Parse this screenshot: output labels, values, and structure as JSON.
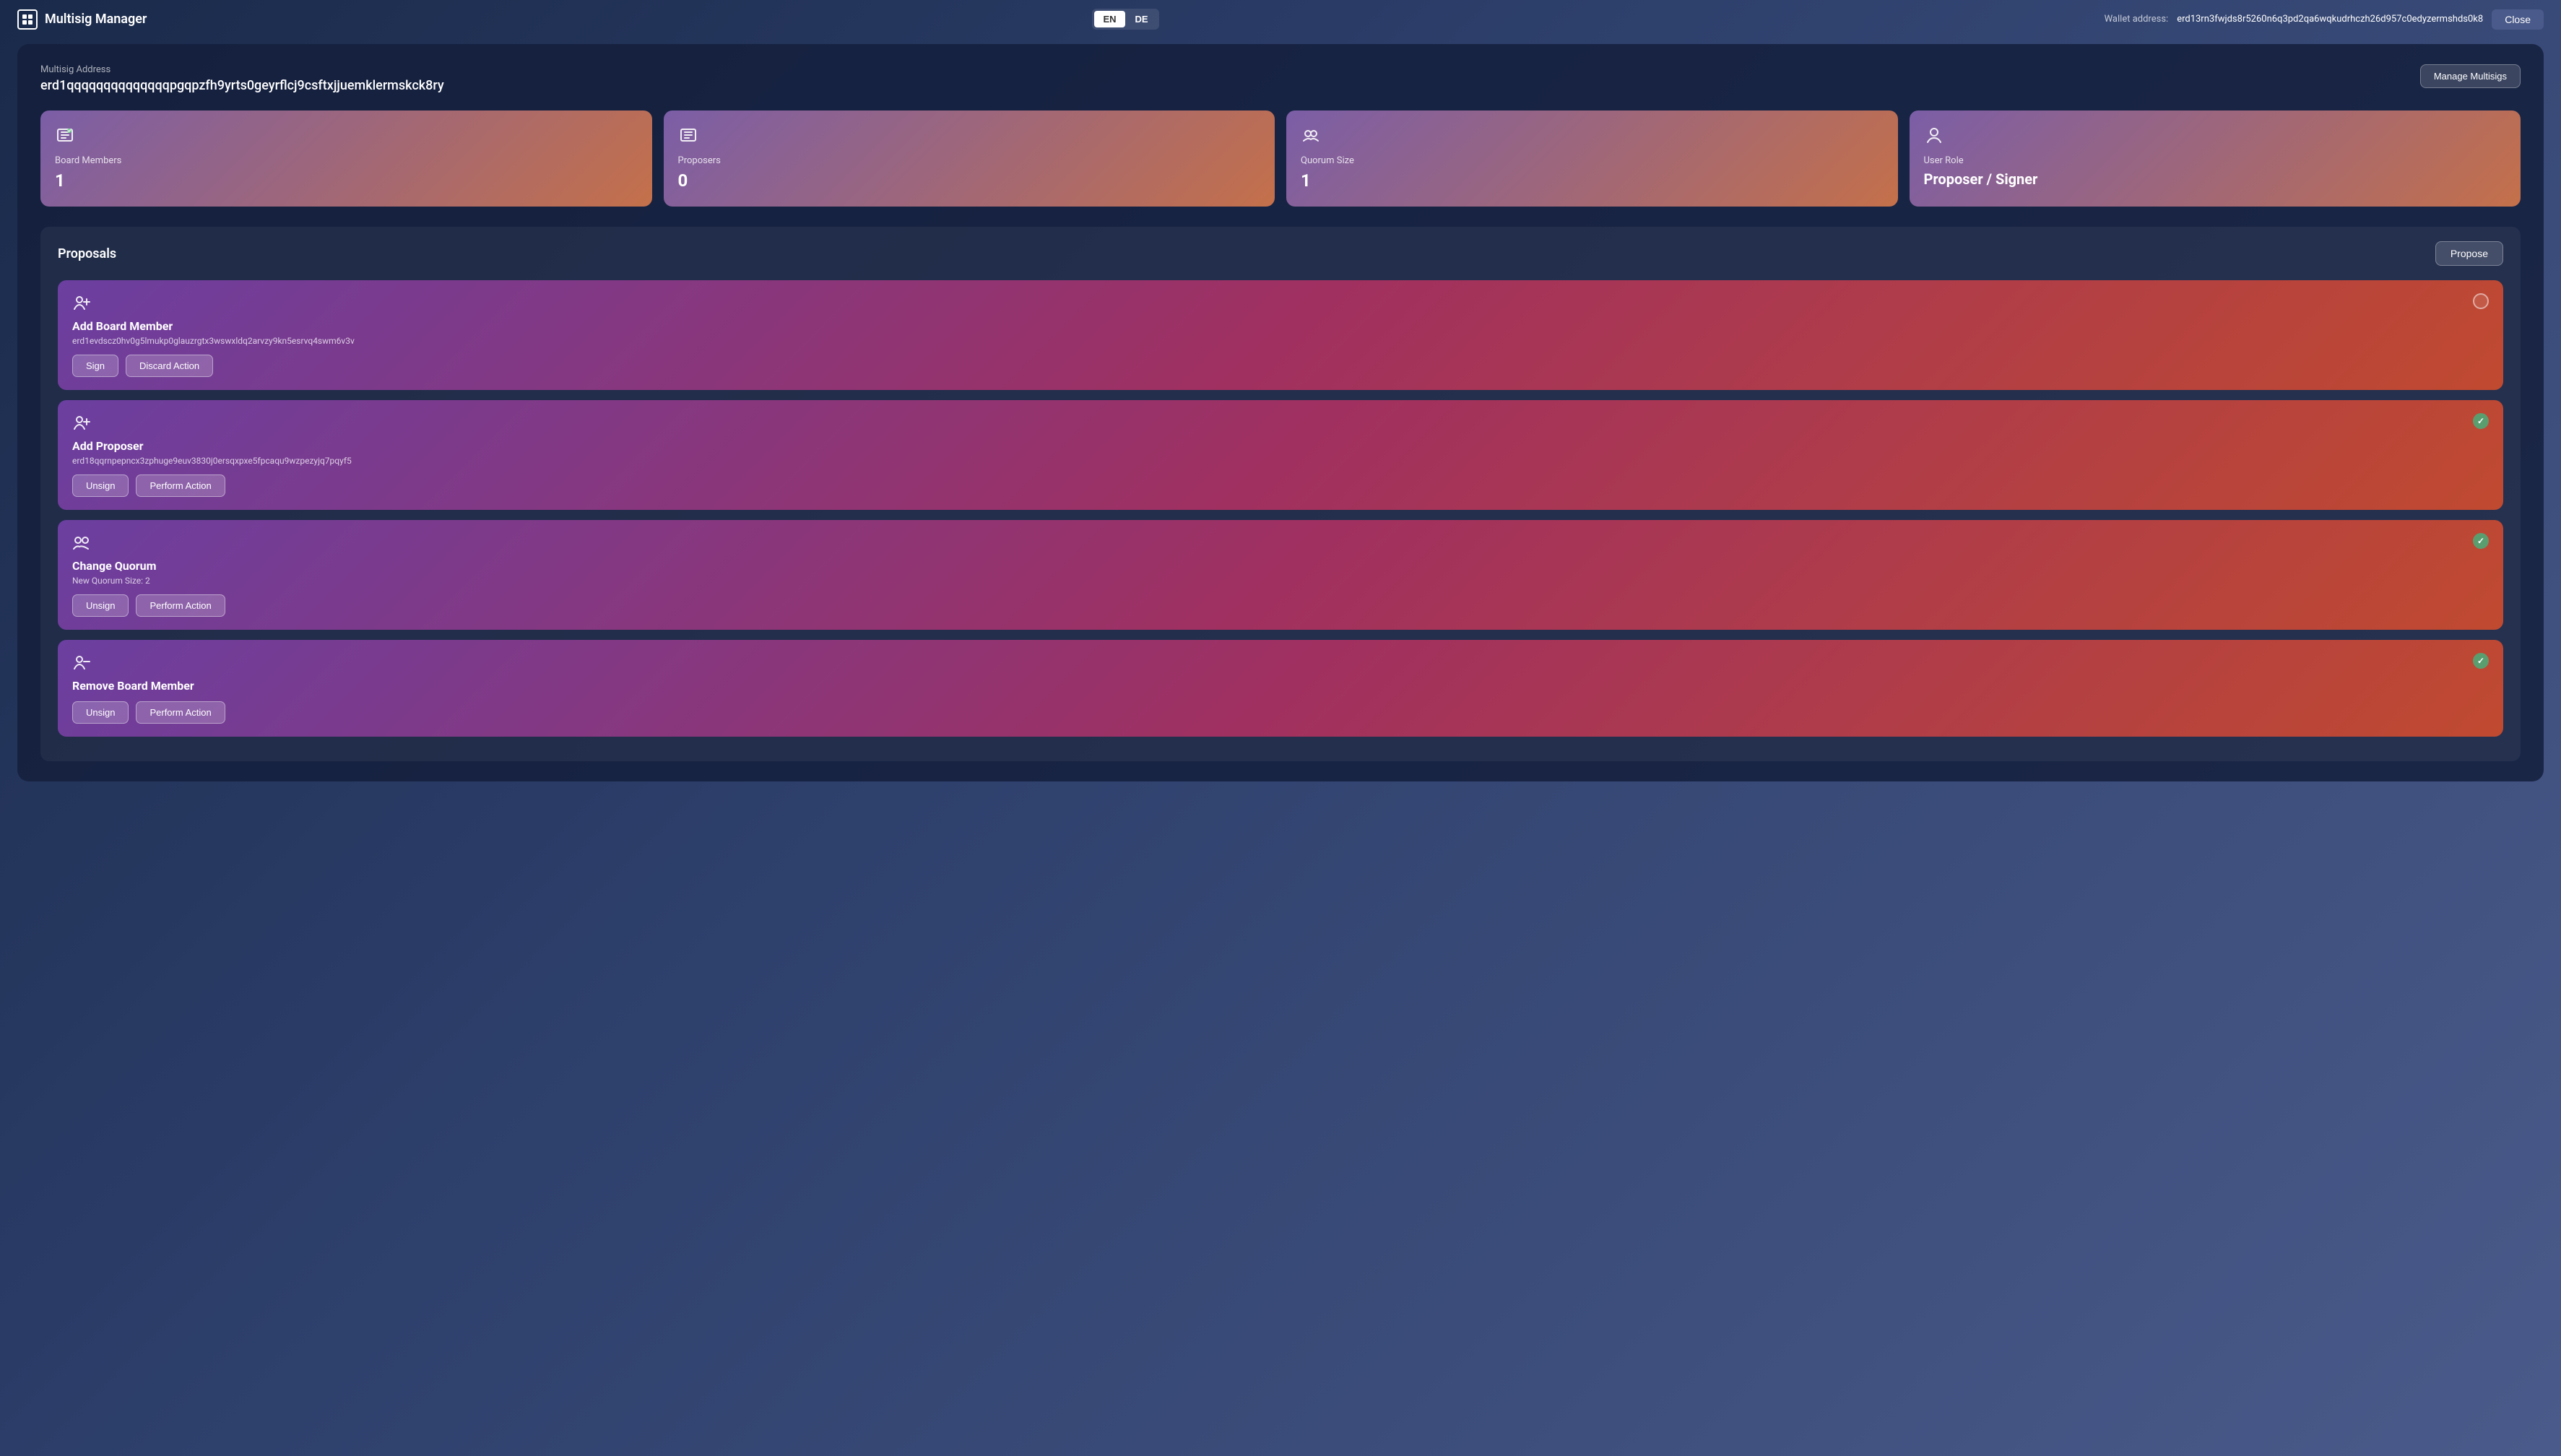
{
  "app": {
    "title": "Multisig Manager"
  },
  "header": {
    "lang_en": "EN",
    "lang_de": "DE",
    "wallet_label": "Wallet address:",
    "wallet_address": "erd13rn3fwjds8r5260n6q3pd2qa6wqkudrhczh26d957c0edyzermshds0k8",
    "close_label": "Close"
  },
  "multisig": {
    "address_label": "Multisig Address",
    "address_value": "erd1qqqqqqqqqqqqqqpgqpzfh9yrts0geyrflcj9csftxjjuemklermskck8ry",
    "manage_label": "Manage Multisigs"
  },
  "stats": [
    {
      "id": "board-members",
      "label": "Board Members",
      "value": "1",
      "icon": "board-icon"
    },
    {
      "id": "proposers",
      "label": "Proposers",
      "value": "0",
      "icon": "proposers-icon"
    },
    {
      "id": "quorum-size",
      "label": "Quorum Size",
      "value": "1",
      "icon": "quorum-icon"
    },
    {
      "id": "user-role",
      "label": "User Role",
      "value": "Proposer / Signer",
      "icon": "user-role-icon"
    }
  ],
  "proposals": {
    "title": "Proposals",
    "propose_label": "Propose",
    "items": [
      {
        "id": "proposal-1",
        "title": "Add Board Member",
        "address": "erd1evdscz0hv0g5lmukp0glauzrgtx3wswxldq2arvzy9kn5esrvq4swm6v3v",
        "status": "empty",
        "actions": [
          {
            "id": "sign-btn-1",
            "label": "Sign",
            "type": "sign"
          },
          {
            "id": "discard-btn-1",
            "label": "Discard Action",
            "type": "discard"
          }
        ]
      },
      {
        "id": "proposal-2",
        "title": "Add Proposer",
        "address": "erd18qqrnpepncx3zphuge9euv3830j0ersqxpxe5fpcaqu9wzpezyjq7pqyf5",
        "status": "checked",
        "actions": [
          {
            "id": "unsign-btn-2",
            "label": "Unsign",
            "type": "unsign"
          },
          {
            "id": "perform-btn-2",
            "label": "Perform Action",
            "type": "perform"
          }
        ]
      },
      {
        "id": "proposal-3",
        "title": "Change Quorum",
        "address": "New Quorum Size: 2",
        "status": "checked",
        "actions": [
          {
            "id": "unsign-btn-3",
            "label": "Unsign",
            "type": "unsign"
          },
          {
            "id": "perform-btn-3",
            "label": "Perform Action",
            "type": "perform"
          }
        ]
      },
      {
        "id": "proposal-4",
        "title": "Remove Board Member",
        "address": "",
        "status": "checked",
        "actions": [
          {
            "id": "unsign-btn-4",
            "label": "Unsign",
            "type": "unsign"
          },
          {
            "id": "perform-btn-4",
            "label": "Perform Action",
            "type": "perform"
          }
        ]
      }
    ]
  }
}
